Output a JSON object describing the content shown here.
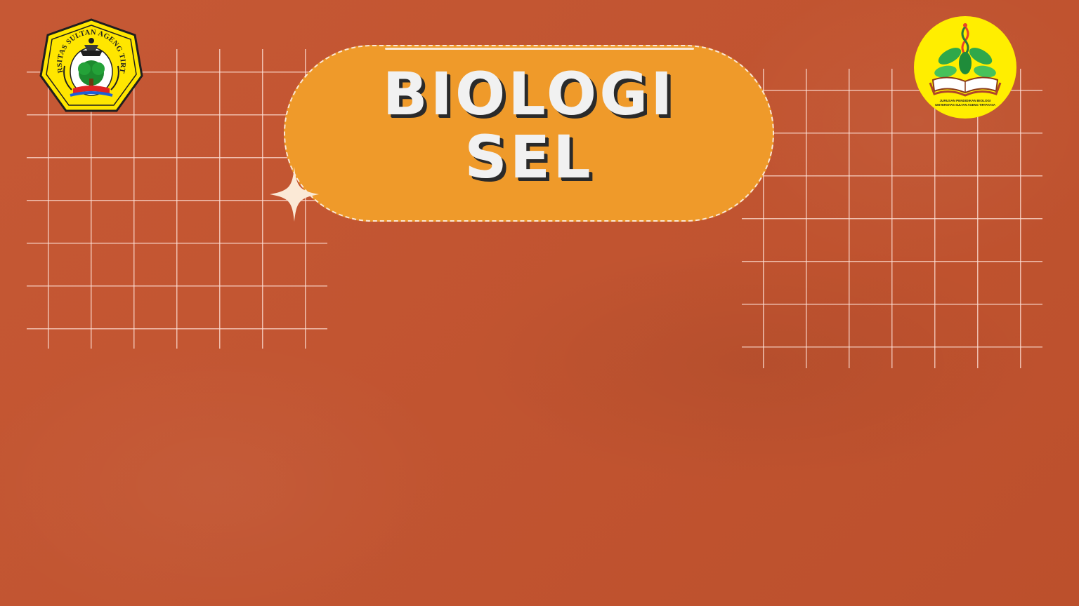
{
  "slide": {
    "title_line_1": "BIOLOGI",
    "title_line_2": "SEL"
  },
  "logos": {
    "left": {
      "icon": "university-crest-icon",
      "text": "UNIVERSITAS SULTAN AGENG TIRTAYASA"
    },
    "right": {
      "icon": "department-emblem-icon",
      "text_line_1": "JURUSAN PENDIDIKAN BIOLOGI",
      "text_line_2": "UNIVERSITAS SULTAN AGENG TIRTAYASA"
    }
  },
  "decorations": {
    "sparkle_icon": "sparkle-icon"
  },
  "colors": {
    "background": "#c4532e",
    "pill": "#ef9a2a",
    "pill_border": "#fbe9d6",
    "title_text": "#f1f1f1",
    "title_shadow": "#2a2a2a",
    "grid_lines": "#ffe1d7",
    "logo_yellow": "#ffee00"
  }
}
